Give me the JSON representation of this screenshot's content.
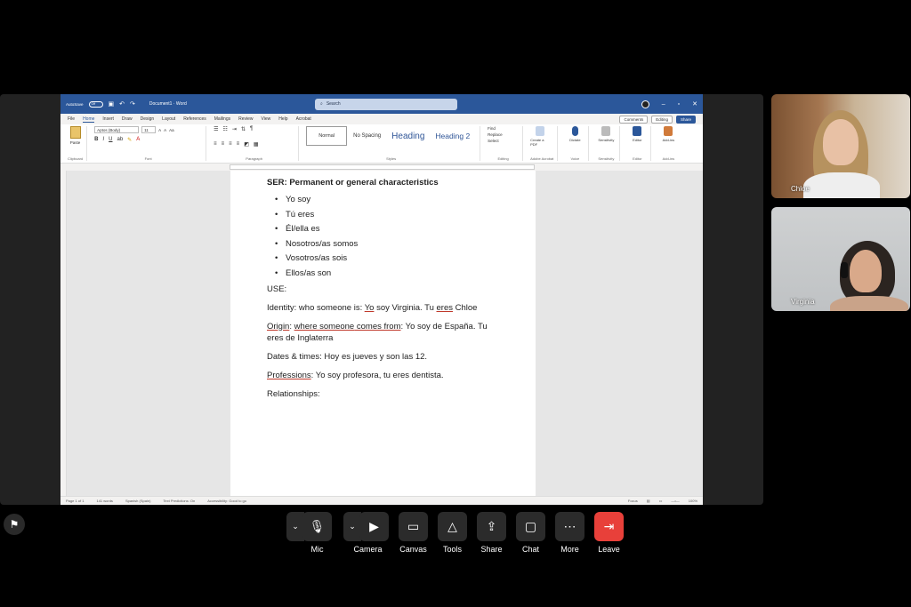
{
  "word": {
    "autosave_label": "AutoSave",
    "autosave_state": "Off",
    "doc_title": "Document1 · Word",
    "search_placeholder": "Search",
    "menu": [
      "File",
      "Home",
      "Insert",
      "Draw",
      "Design",
      "Layout",
      "References",
      "Mailings",
      "Review",
      "View",
      "Help",
      "Acrobat"
    ],
    "comments_label": "Comments",
    "editing_label": "Editing",
    "share_label": "Share",
    "paste_label": "Paste",
    "font_name": "Aptos (Body)",
    "font_size": "11",
    "styles": [
      "Normal",
      "No Spacing",
      "Heading",
      "Heading 2"
    ],
    "find_label": "Find",
    "replace_label": "Replace",
    "select_label": "Select",
    "group_labels": [
      "Clipboard",
      "Font",
      "Paragraph",
      "Styles",
      "Editing",
      "Adobe Acrobat",
      "Voice",
      "Sensitivity",
      "Editor",
      "Add-ins"
    ],
    "ribbon_icons": [
      {
        "label": "Create a PDF",
        "color": "#c3d3ea"
      },
      {
        "label": "Dictate",
        "color": "#2b579a"
      },
      {
        "label": "Sensitivity",
        "color": "#bbbbbb"
      },
      {
        "label": "Editor",
        "color": "#2b579a"
      },
      {
        "label": "Add-ins",
        "color": "#d07a3a"
      }
    ],
    "status": {
      "page": "Page 1 of 1",
      "words": "141 words",
      "language": "Spanish (Spain)",
      "predictions": "Text Predictions: On",
      "accessibility": "Accessibility: Good to go",
      "focus": "Focus",
      "zoom": "100%"
    }
  },
  "document": {
    "heading": "SER: Permanent or general characteristics",
    "conjugations": [
      "Yo soy",
      "Tú eres",
      "Él/ella es",
      "Nosotros/as somos",
      "Vosotros/as sois",
      "Ellos/as son"
    ],
    "use_label": "USE:",
    "identity_term": "Identity",
    "identity_text": ": who someone is: ",
    "identity_yo": "Yo",
    "identity_mid": " soy Virginia. Tu ",
    "identity_eres": "eres",
    "identity_end": " Chloe",
    "origin_term": "Origin",
    "origin_where": "where someone",
    "origin_comes": " comes from",
    "origin_rest": ": Yo soy de España. Tu eres de Inglaterra",
    "dates_text": "Dates & times: Hoy es jueves y son las 12.",
    "professions_term": "Professions",
    "professions_rest": ": Yo soy profesora, tu eres dentista.",
    "relationships": "Relationships:"
  },
  "participants": [
    {
      "name": "Chloe"
    },
    {
      "name": "Virginia"
    }
  ],
  "controls": {
    "mic": "Mic",
    "camera": "Camera",
    "canvas": "Canvas",
    "tools": "Tools",
    "share": "Share",
    "chat": "Chat",
    "more": "More",
    "leave": "Leave"
  }
}
